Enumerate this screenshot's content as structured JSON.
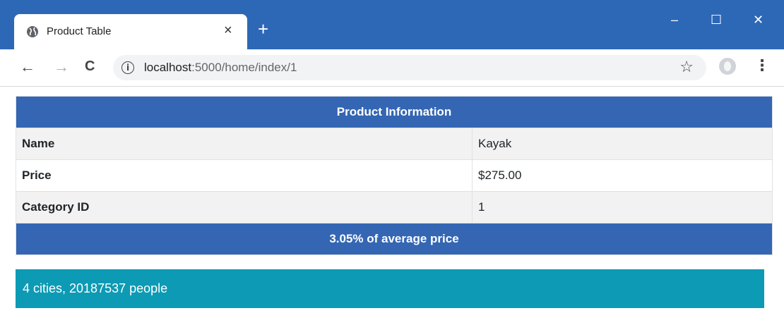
{
  "browser": {
    "tab_title": "Product Table",
    "tab_close": "×",
    "new_tab": "+",
    "window_controls": {
      "minimize": "–",
      "maximize": "☐",
      "close": "✕"
    },
    "nav": {
      "back": "←",
      "forward": "→",
      "reload": "C"
    },
    "url_host": "localhost",
    "url_rest": ":5000/home/index/1",
    "star": "☆",
    "menu": "⋮",
    "theme_color": "#2d68b6"
  },
  "product_table": {
    "header": "Product Information",
    "rows": [
      {
        "label": "Name",
        "value": "Kayak"
      },
      {
        "label": "Price",
        "value": "$275.00"
      },
      {
        "label": "Category ID",
        "value": "1"
      }
    ],
    "footer": "3.05% of average price",
    "header_color": "#3466b3"
  },
  "cities_summary": {
    "text": "4 cities, 20187537 people",
    "color": "#0d9ab4"
  }
}
